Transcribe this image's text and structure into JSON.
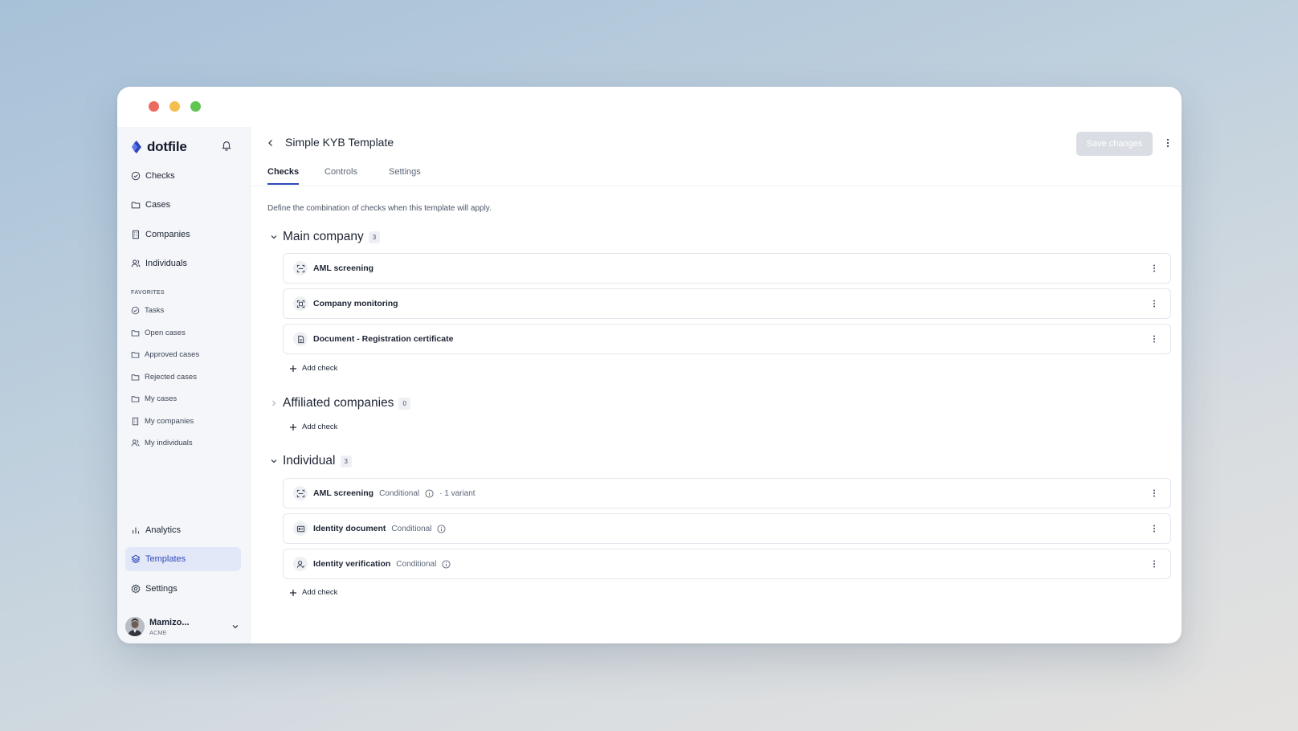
{
  "window": {
    "controls": [
      "close",
      "minimize",
      "maximize"
    ]
  },
  "sidebar": {
    "brand": "dotfile",
    "nav": [
      {
        "label": "Checks",
        "icon": "check-circle-icon"
      },
      {
        "label": "Cases",
        "icon": "folder-icon"
      },
      {
        "label": "Companies",
        "icon": "building-icon"
      },
      {
        "label": "Individuals",
        "icon": "users-icon"
      }
    ],
    "favorites_heading": "FAVORITES",
    "favorites": [
      {
        "label": "Tasks",
        "icon": "check-circle-icon"
      },
      {
        "label": "Open cases",
        "icon": "folder-icon"
      },
      {
        "label": "Approved cases",
        "icon": "folder-icon"
      },
      {
        "label": "Rejected cases",
        "icon": "folder-icon"
      },
      {
        "label": "My cases",
        "icon": "folder-icon"
      },
      {
        "label": "My companies",
        "icon": "building-icon"
      },
      {
        "label": "My individuals",
        "icon": "users-icon"
      }
    ],
    "bottom_nav": [
      {
        "label": "Analytics",
        "icon": "bar-chart-icon"
      },
      {
        "label": "Templates",
        "icon": "layers-icon",
        "active": true
      },
      {
        "label": "Settings",
        "icon": "gear-icon"
      }
    ],
    "user": {
      "name": "Mamizo...",
      "org": "ACME"
    }
  },
  "header": {
    "title": "Simple KYB Template",
    "save_label": "Save changes"
  },
  "tabs": [
    {
      "label": "Checks",
      "active": true
    },
    {
      "label": "Controls"
    },
    {
      "label": "Settings"
    }
  ],
  "description": "Define the combination of checks when this template will apply.",
  "sections": [
    {
      "title": "Main company",
      "count": "3",
      "expanded": true,
      "checks": [
        {
          "name": "AML screening",
          "icon": "aml-scan-icon"
        },
        {
          "name": "Company monitoring",
          "icon": "monitoring-icon"
        },
        {
          "name": "Document - Registration certificate",
          "icon": "document-icon"
        }
      ],
      "add_label": "Add check"
    },
    {
      "title": "Affiliated companies",
      "count": "0",
      "expanded": false,
      "checks": [],
      "add_label": "Add check"
    },
    {
      "title": "Individual",
      "count": "3",
      "expanded": true,
      "checks": [
        {
          "name": "AML screening",
          "conditional": "Conditional",
          "variant": "· 1 variant",
          "icon": "aml-scan-icon"
        },
        {
          "name": "Identity document",
          "conditional": "Conditional",
          "icon": "id-card-icon"
        },
        {
          "name": "Identity verification",
          "conditional": "Conditional",
          "icon": "user-check-icon"
        }
      ],
      "add_label": "Add check"
    }
  ],
  "colors": {
    "accent": "#3048b8",
    "active_bg": "#e3e8f8",
    "save_disabled": "#dadde3"
  }
}
